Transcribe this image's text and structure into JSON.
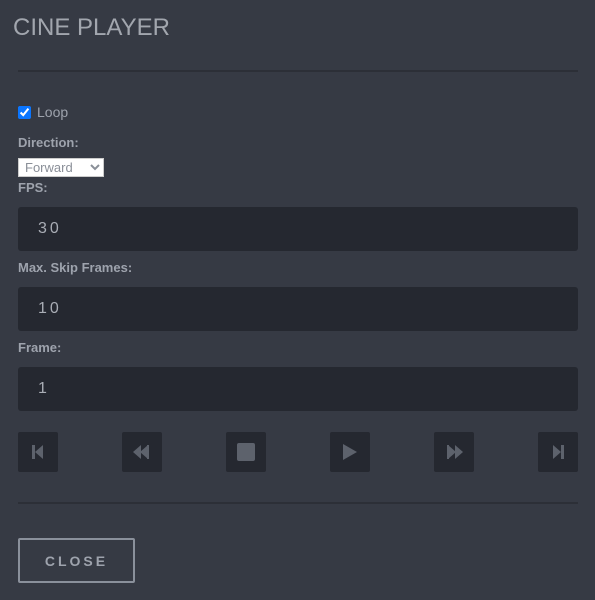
{
  "title": "CINE PLAYER",
  "loop": {
    "label": "Loop",
    "checked": true
  },
  "direction": {
    "label": "Direction:",
    "value": "Forward"
  },
  "fps": {
    "label": "FPS:",
    "value": "30"
  },
  "max_skip": {
    "label": "Max. Skip Frames:",
    "value": "10"
  },
  "frame": {
    "label": "Frame:",
    "value": "1"
  },
  "controls": [
    "first-frame-icon",
    "rewind-icon",
    "stop-icon",
    "play-icon",
    "fast-forward-icon",
    "last-frame-icon"
  ],
  "close_label": "CLOSE",
  "colors": {
    "background": "#363a44",
    "input": "#252830",
    "accent": "#0a75ff"
  }
}
